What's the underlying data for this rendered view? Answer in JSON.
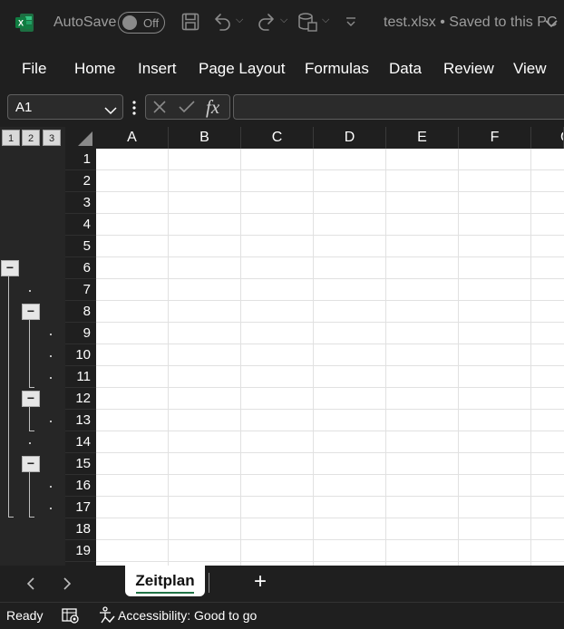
{
  "titlebar": {
    "autosave_label": "AutoSave",
    "autosave_toggle": "Off",
    "file_status": "test.xlsx • Saved to this PC",
    "app_icon_letter": "X"
  },
  "menu": {
    "items": [
      "File",
      "Home",
      "Insert",
      "Page Layout",
      "Formulas",
      "Data",
      "Review",
      "View"
    ]
  },
  "formula_bar": {
    "name_box_value": "A1",
    "fx_label": "fx",
    "formula_value": ""
  },
  "grid": {
    "outline_levels": [
      "1",
      "2",
      "3"
    ],
    "columns": [
      "A",
      "B",
      "C",
      "D",
      "E",
      "F",
      "G"
    ],
    "rows": [
      "1",
      "2",
      "3",
      "4",
      "5",
      "6",
      "7",
      "8",
      "9",
      "10",
      "11",
      "12",
      "13",
      "14",
      "15",
      "16",
      "17",
      "18",
      "19"
    ],
    "collapse_symbol": "−"
  },
  "sheets": {
    "active": "Zeitplan",
    "add_symbol": "+"
  },
  "status": {
    "ready": "Ready",
    "accessibility": "Accessibility: Good to go"
  },
  "colors": {
    "excel_green": "#217346",
    "chrome_bg": "#1f1f1f"
  }
}
